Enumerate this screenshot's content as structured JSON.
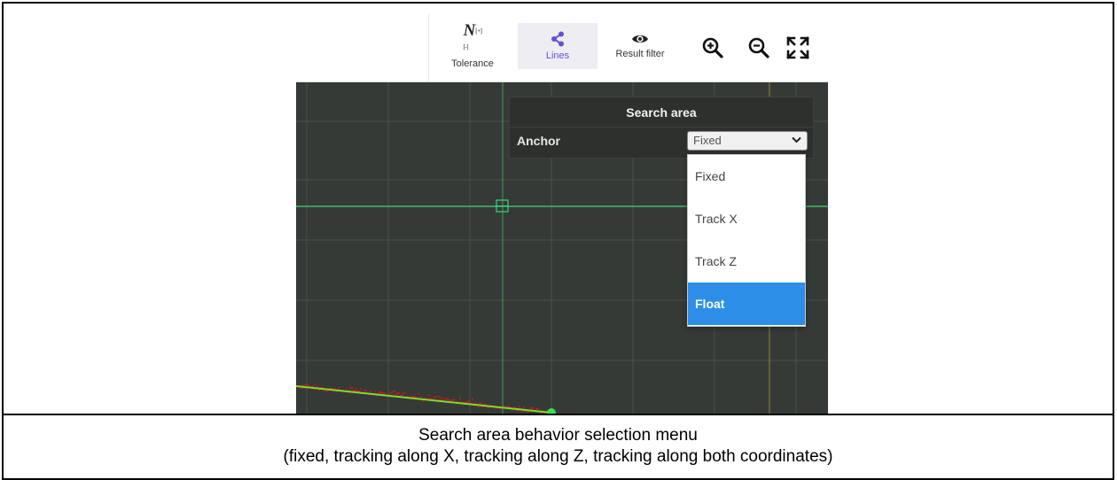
{
  "toolbar": {
    "tolerance": {
      "symbol": "N",
      "sub": "[+1]\n[-1]",
      "label": "Tolerance",
      "icon": "tolerance-icon"
    },
    "lines": {
      "label": "Lines",
      "icon": "share-nodes-icon",
      "active": true
    },
    "result_filter": {
      "label": "Result filter",
      "icon": "eye-icon"
    },
    "zoom_in_icon": "zoom-in-icon",
    "zoom_out_icon": "zoom-out-icon",
    "fit_icon": "fit-expand-icon"
  },
  "search_area": {
    "title": "Search area",
    "anchor_label": "Anchor",
    "anchor_value": "Fixed",
    "options": [
      "Fixed",
      "Track X",
      "Track Z",
      "Float"
    ],
    "highlighted_option": "Float"
  },
  "caption": {
    "line1": "Search area behavior selection menu",
    "line2": "(fixed, tracking along X, tracking along Z, tracking along both coordinates)"
  },
  "colors": {
    "canvas_bg": "#363a36",
    "grid": "#4a504a",
    "green_line": "#3fd37a",
    "fit_line": "#7ddc2c",
    "points": "#e0141e",
    "selected_option": "#2d8ee8",
    "active_tab": "#6a4fd6"
  }
}
